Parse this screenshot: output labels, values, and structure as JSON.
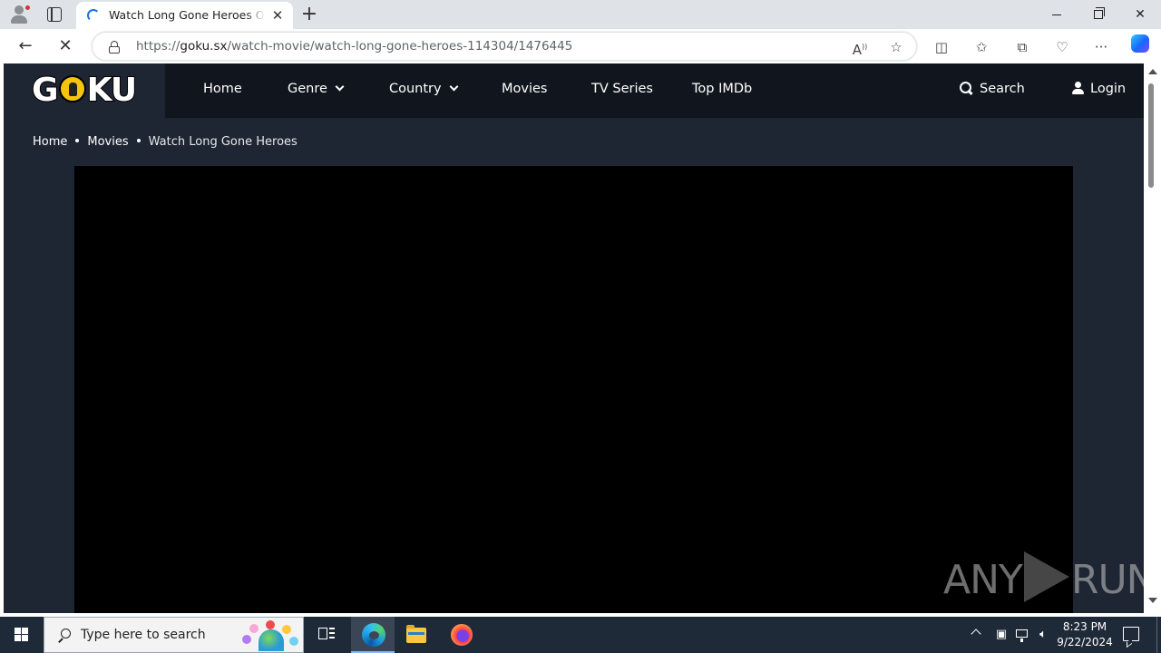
{
  "browser": {
    "tab_title": "Watch Long Gone Heroes Online",
    "url_prefix": "https://",
    "url_domain": "goku.sx",
    "url_path": "/watch-movie/watch-long-gone-heroes-114304/1476445"
  },
  "site": {
    "logo_text_left": "G",
    "logo_text_right": "KU",
    "nav": {
      "home": "Home",
      "genre": "Genre",
      "country": "Country",
      "movies": "Movies",
      "tv_series": "TV Series",
      "top_imdb": "Top IMDb"
    },
    "search_label": "Search",
    "login_label": "Login",
    "breadcrumb": [
      "Home",
      "Movies",
      "Watch Long Gone Heroes"
    ],
    "accent_color": "#f4c40f",
    "header_color": "#11161e",
    "page_bg_color": "#1e2633"
  },
  "watermark": {
    "left": "ANY",
    "right": "RUN"
  },
  "taskbar": {
    "search_placeholder": "Type here to search",
    "time": "8:23 PM",
    "date": "9/22/2024"
  }
}
